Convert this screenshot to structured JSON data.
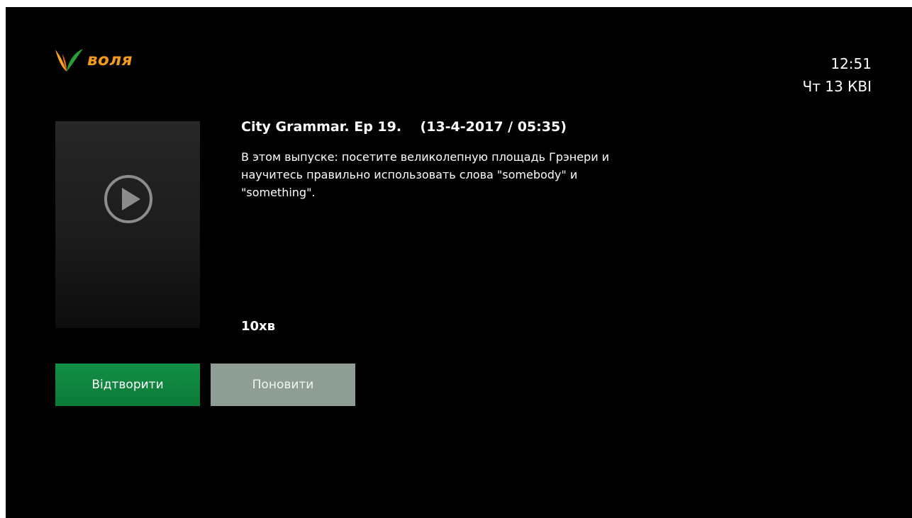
{
  "brand": {
    "name": "воля",
    "colors": {
      "accent": "#f39a1c",
      "leaf_green": "#27a136"
    }
  },
  "clock": {
    "time": "12:51",
    "date": "Чт 13 КВІ"
  },
  "program": {
    "title": "City Grammar. Ep 19.    (13-4-2017 / 05:35)",
    "description": "В этом выпуске: посетите великолепную площадь Грэнери и научитесь правильно использовать слова \"somebody\" и \"something\".",
    "duration": "10хв",
    "poster_icon": "play-circle-icon"
  },
  "actions": {
    "play_label": "Відтворити",
    "refresh_label": "Поновити",
    "colors": {
      "play": "#0f8a40",
      "refresh": "#8e9e94"
    }
  }
}
